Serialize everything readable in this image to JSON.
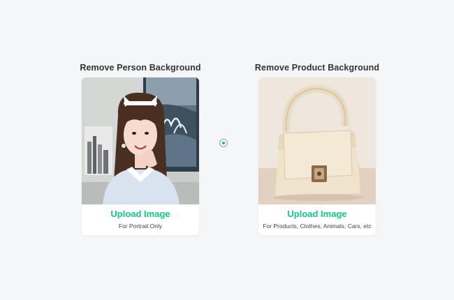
{
  "person": {
    "title": "Remove Person Background",
    "upload_label": "Upload Image",
    "note": "For Portrait Only"
  },
  "product": {
    "title": "Remove Product Background",
    "upload_label": "Upload Image",
    "note": "For Products, Clothes, Animals, Cars, etc"
  },
  "colors": {
    "accent": "#16c784",
    "page_bg": "#f5f6f8",
    "card_bg": "#ffffff",
    "title_text": "#333333"
  },
  "icons": {
    "divider": "circle-dot-icon"
  }
}
